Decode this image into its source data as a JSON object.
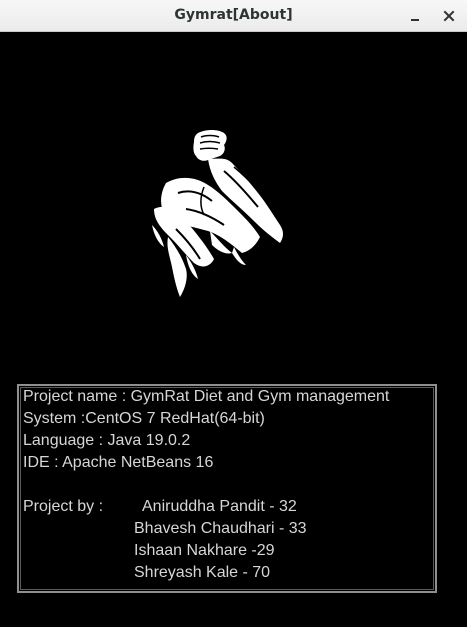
{
  "window": {
    "title": "Gymrat[About]",
    "minimize_label": "—",
    "close_label": "✕"
  },
  "logo": {
    "icon": "flexed-arm-muscle-icon",
    "color": "#ffffff"
  },
  "info": {
    "project_name": "Project name : GymRat Diet and Gym management",
    "system": "System :CentOS 7 RedHat(64-bit)",
    "language": "Language : Java 19.0.2",
    "ide": "IDE : Apache NetBeans 16",
    "project_by_label": "Project by :",
    "members": [
      "Aniruddha Pandit - 32",
      "Bhavesh Chaudhari - 33",
      "Ishaan Nakhare -29",
      "Shreyash Kale - 70"
    ]
  },
  "colors": {
    "background": "#000000",
    "titlebar": "#ebebeb",
    "text": "#d6d6d6",
    "border": "#8f8f8f"
  }
}
